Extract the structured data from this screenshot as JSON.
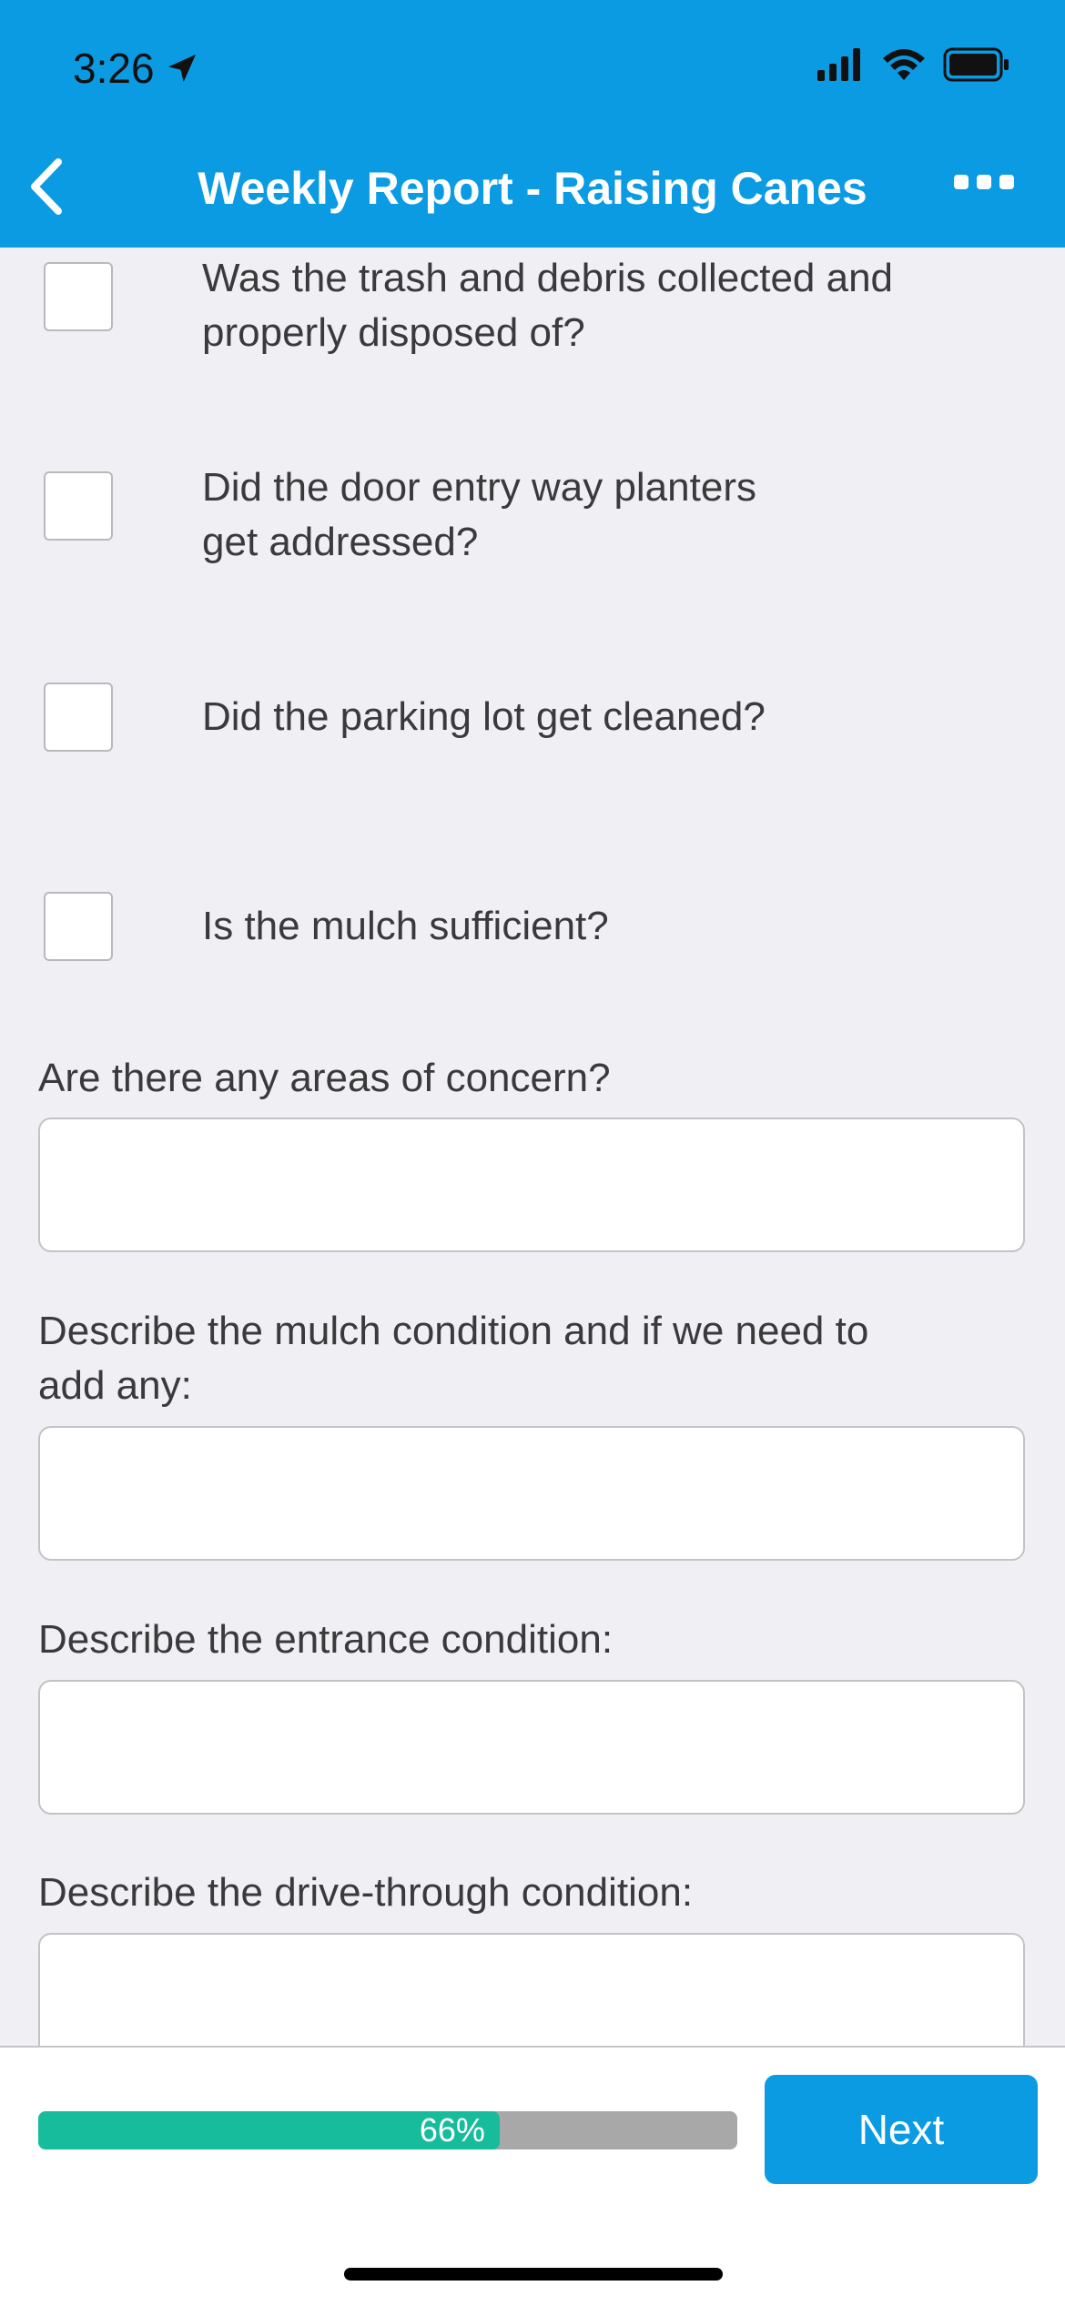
{
  "status_bar": {
    "time": "3:26"
  },
  "nav": {
    "title": "Weekly Report - Raising Canes"
  },
  "checklist": [
    {
      "label_line1": "Was the trash and debris collected and",
      "label_line2": "properly disposed of?",
      "checked": false
    },
    {
      "label_line1": "Did the door entry way planters",
      "label_line2": "get addressed?",
      "checked": false
    },
    {
      "label_line1": "Did the parking lot get cleaned?",
      "label_line2": "",
      "checked": false
    },
    {
      "label_line1": "Is the mulch sufficient?",
      "label_line2": "",
      "checked": false
    }
  ],
  "fields": [
    {
      "label_line1": "Are there any areas of concern?",
      "label_line2": "",
      "value": ""
    },
    {
      "label_line1": "Describe the mulch condition and if we need to",
      "label_line2": "add any:",
      "value": ""
    },
    {
      "label_line1": "Describe the entrance condition:",
      "label_line2": "",
      "value": ""
    },
    {
      "label_line1": "Describe the drive-through condition:",
      "label_line2": "",
      "value": ""
    }
  ],
  "footer": {
    "progress_percent": 66,
    "progress_text": "66%",
    "next_label": "Next"
  },
  "colors": {
    "header": "#0b9be3",
    "progress_fill": "#17bc9c",
    "progress_track": "#a8a8a8",
    "background": "#efeff4"
  }
}
